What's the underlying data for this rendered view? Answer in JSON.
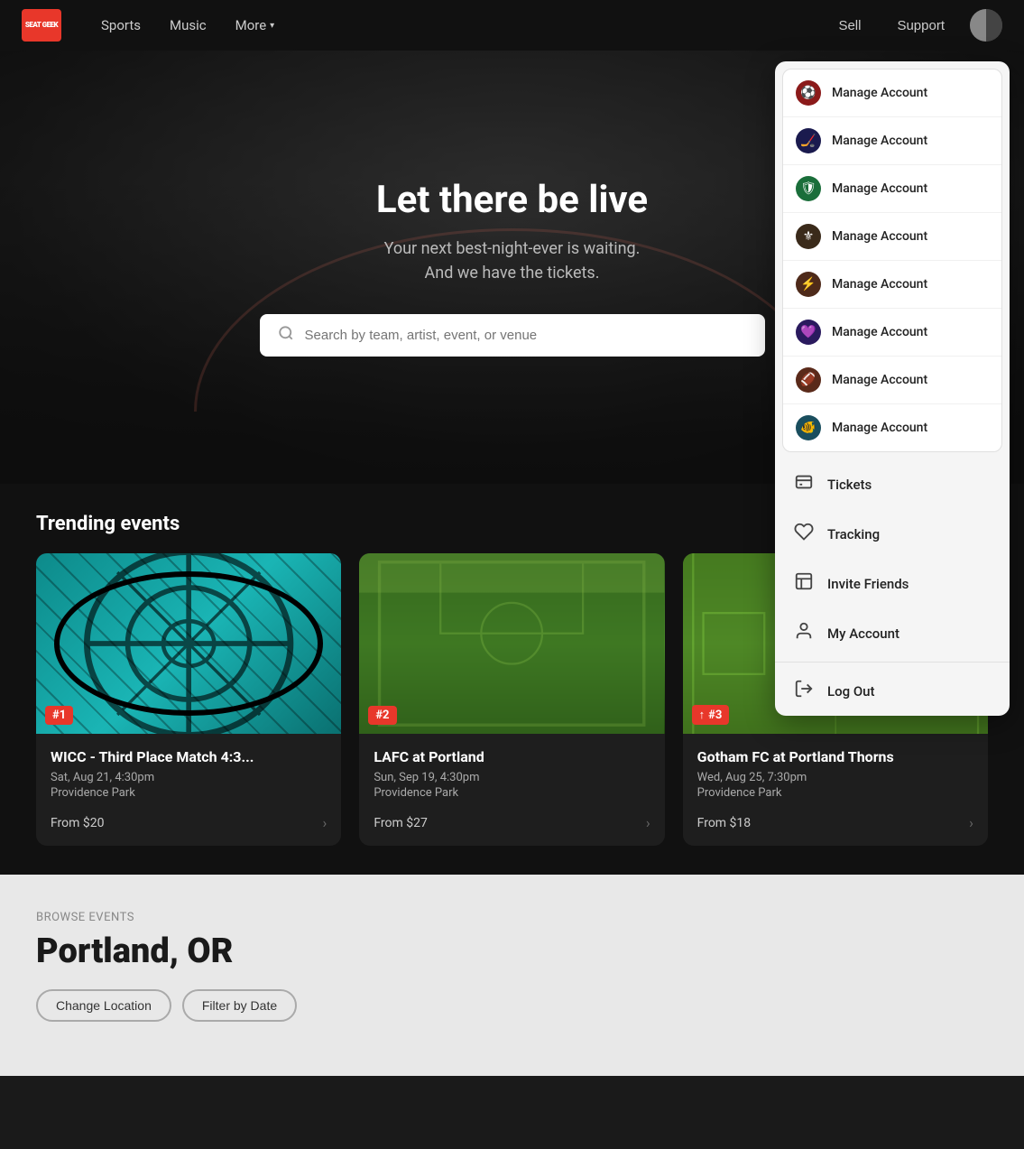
{
  "nav": {
    "logo": "SEAT GEEK",
    "links": [
      {
        "label": "Sports",
        "id": "sports"
      },
      {
        "label": "Music",
        "id": "music"
      },
      {
        "label": "More",
        "id": "more"
      }
    ],
    "sell_label": "Sell",
    "support_label": "Support"
  },
  "hero": {
    "title": "Let there be live",
    "subtitle_line1": "Your next best-night-ever is waiting.",
    "subtitle_line2": "And we have the tickets.",
    "search_placeholder": "Search by team, artist, event, or venue"
  },
  "trending": {
    "section_title": "Trending events",
    "cards": [
      {
        "rank": "#1",
        "rank_up": false,
        "title": "WICC - Third Place Match 4:3...",
        "date": "Sat, Aug 21, 4:30pm",
        "venue": "Providence Park",
        "price": "From $20",
        "image_type": "teal-pattern"
      },
      {
        "rank": "#2",
        "rank_up": false,
        "title": "LAFC at Portland",
        "date": "Sun, Sep 19, 4:30pm",
        "venue": "Providence Park",
        "price": "From $27",
        "image_type": "green-stadium"
      },
      {
        "rank": "#3",
        "rank_up": true,
        "title": "Gotham FC at Portland Thorns",
        "date": "Wed, Aug 25, 7:30pm",
        "venue": "Providence Park",
        "price": "From $18",
        "image_type": "green-field"
      }
    ]
  },
  "browse": {
    "label": "Browse Events",
    "city": "Portland, OR",
    "buttons": [
      {
        "label": "Change Location"
      },
      {
        "label": "Filter by Date"
      }
    ]
  },
  "dropdown": {
    "accounts": [
      {
        "label": "Manage Account",
        "icon": "⚽",
        "bg": "#8b1a1a"
      },
      {
        "label": "Manage Account",
        "icon": "🏒",
        "bg": "#1a1a4e"
      },
      {
        "label": "Manage Account",
        "icon": "🛡",
        "bg": "#1a4e3a"
      },
      {
        "label": "Manage Account",
        "icon": "⚜",
        "bg": "#2a1a1a"
      },
      {
        "label": "Manage Account",
        "icon": "⚡",
        "bg": "#4e2a1a"
      },
      {
        "label": "Manage Account",
        "icon": "🔮",
        "bg": "#2a1a4e"
      },
      {
        "label": "Manage Account",
        "icon": "🏈",
        "bg": "#3a1a1a"
      },
      {
        "label": "Manage Account",
        "icon": "🐟",
        "bg": "#1a3a4e"
      }
    ],
    "menu_items": [
      {
        "label": "Tickets",
        "icon": "📋",
        "id": "tickets"
      },
      {
        "label": "Tracking",
        "icon": "♡",
        "id": "tracking"
      },
      {
        "label": "Invite Friends",
        "icon": "🎁",
        "id": "invite"
      },
      {
        "label": "My Account",
        "icon": "👤",
        "id": "my-account"
      }
    ],
    "logout_label": "Log Out",
    "logout_icon": "→"
  }
}
